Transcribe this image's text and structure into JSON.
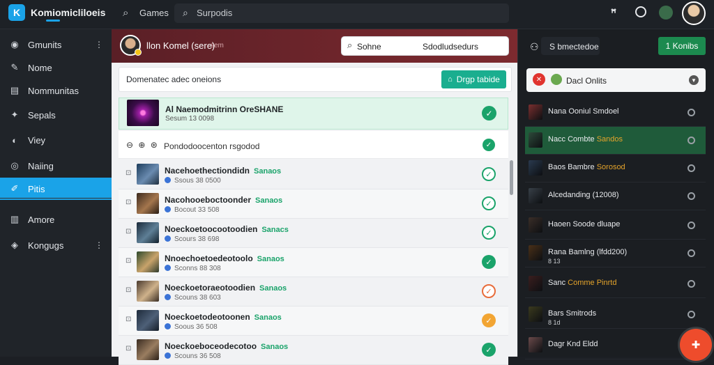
{
  "app": {
    "title": "Komiomicliloeis",
    "logo_glyph": "K"
  },
  "topbar": {
    "nav_games": "Games",
    "search_placeholder": "Surpodis"
  },
  "sidebar": {
    "items": [
      {
        "label": "Gmunits",
        "icon": "globe-icon"
      },
      {
        "label": "Nome",
        "icon": "pin-icon"
      },
      {
        "label": "Nommunitas",
        "icon": "list-icon"
      },
      {
        "label": "Sepals",
        "icon": "sparkle-icon"
      },
      {
        "label": "Viey",
        "icon": "eye-icon"
      },
      {
        "label": "Naiing",
        "icon": "target-icon"
      },
      {
        "label": "Pitis",
        "icon": "pen-icon"
      },
      {
        "label": "Amore",
        "icon": "box-icon"
      },
      {
        "label": "Kongugs",
        "icon": "gamepad-icon"
      }
    ],
    "active_index": 6
  },
  "header": {
    "user_name": "llon Komel (sere)",
    "user_sub": "sem",
    "filter_label": "Sohne",
    "filter_value": "Sdodludsedurs"
  },
  "toolbar": {
    "title": "Domenatec adec oneions",
    "drop_label": "Drgp tabide"
  },
  "featured": {
    "title": "Al Naemodmitrinn OreSHANE",
    "meta": "Sesum 13 0098"
  },
  "people_row": {
    "icons": "⊖ ⊕ ⊛",
    "text": "Pondodoocenton rsgodod"
  },
  "rows": [
    {
      "title": "Nacehoethectiondidn",
      "tag": "Sanaos",
      "meta": "Ssous 38 0500",
      "status": "outline-green"
    },
    {
      "title": "Nacohooeboctoonder",
      "tag": "Sanaos",
      "meta": "Bocout 33 508",
      "status": "outline-green"
    },
    {
      "title": "Noeckoetoocootoodien",
      "tag": "Sanacs",
      "meta": "Scours 38 698",
      "status": "outline-green"
    },
    {
      "title": "Nnoechoetoedeotoolo",
      "tag": "Sanaos",
      "meta": "Sconns 88 308",
      "status": "filled-green"
    },
    {
      "title": "Noeckoetoraeotoodien",
      "tag": "Sanaos",
      "meta": "Scouns 38 603",
      "status": "outline-orange"
    },
    {
      "title": "Noeckoetodeotoonen",
      "tag": "Sanaos",
      "meta": "Soous 36 508",
      "status": "filled-orange"
    },
    {
      "title": "Noeckoeboceodecotoo",
      "tag": "Sanaos",
      "meta": "Scouns 36 508",
      "status": "filled-green-partial"
    }
  ],
  "right": {
    "label": "S bmectedoe",
    "button_label": "1 Konibs",
    "select_text": "Dacl Onlits",
    "items": [
      {
        "title": "Nana Ooniul Smdoel",
        "hl": "",
        "sub": "",
        "active": false
      },
      {
        "title": "Nacc Combte ",
        "hl": "Sandos",
        "sub": "",
        "active": true
      },
      {
        "title": "Baos Bambre ",
        "hl": "Sorosod",
        "sub": "",
        "active": false
      },
      {
        "title": "Alcedanding (12008)",
        "hl": "",
        "sub": "",
        "active": false
      },
      {
        "title": "Haoen Soode dluape",
        "hl": "",
        "sub": "",
        "active": false
      },
      {
        "title": "Rana Bamlng (lfdd200)",
        "hl": "",
        "sub": "8 13",
        "active": false
      },
      {
        "title": "Sanc ",
        "hl": "Comme Pinrtd",
        "sub": "",
        "active": false
      },
      {
        "title": "Bars Smitrods",
        "hl": "",
        "sub": "8 1d",
        "active": false
      },
      {
        "title": "Dagr Knd Eldd",
        "hl": "",
        "sub": "",
        "active": false
      }
    ]
  },
  "colors": {
    "accent": "#1aa3e8",
    "green": "#1aa36a",
    "header": "#7d2a2f",
    "fab": "#ee4c2c"
  }
}
